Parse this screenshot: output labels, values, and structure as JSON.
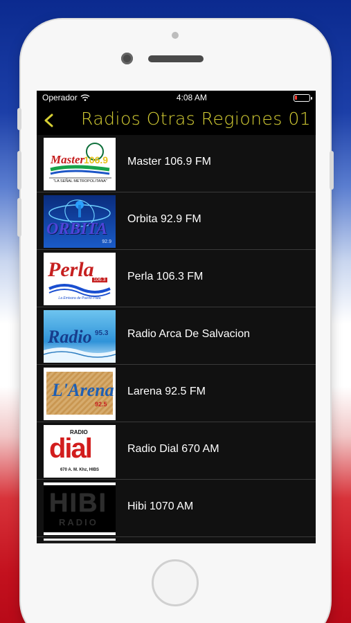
{
  "status": {
    "carrier": "Operador",
    "time": "4:08 AM",
    "battery_level": 0.15
  },
  "navbar": {
    "back_icon": "chevron-left-icon",
    "title": "Radios Otras Regiones 01"
  },
  "stations": [
    {
      "name": "Master 106.9 FM",
      "logo_text": "Master",
      "logo_freq": "106.9",
      "logo_tagline": "\"LA SEÑAL METROPOLITANA\""
    },
    {
      "name": "Orbita 92.9 FM",
      "logo_text": "ORBITA",
      "logo_freq": "92.9"
    },
    {
      "name": "Perla 106.3 FM",
      "logo_text": "Perla",
      "logo_freq": "106.3",
      "logo_tagline": "La Emisora de Puerto Plata"
    },
    {
      "name": "Radio Arca De Salvacion",
      "logo_text": "Radio",
      "logo_freq": "95.3"
    },
    {
      "name": "Larena 92.5 FM",
      "logo_text": "L'Arena",
      "logo_freq": "92.5"
    },
    {
      "name": "Radio Dial 670 AM",
      "logo_text": "dial",
      "logo_top": "RADIO",
      "logo_tagline": "670 A. M. Khz, HIBS"
    },
    {
      "name": "Hibi 1070 AM",
      "logo_text": "HIBI",
      "logo_bottom": "RADIO"
    }
  ],
  "colors": {
    "title": "#d6cf34",
    "background": "#000000",
    "row_separator": "#3a3a3a"
  }
}
